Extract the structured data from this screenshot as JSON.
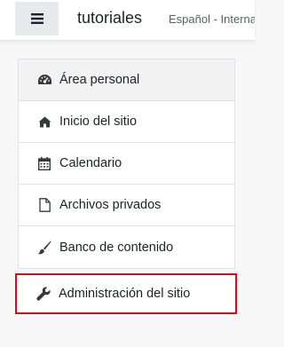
{
  "navbar": {
    "site_name": "tutoriales",
    "language": "Español - Internacional",
    "menu_icon": "hamburger-icon"
  },
  "drawer": {
    "items": [
      {
        "label": "Área personal",
        "icon": "dashboard-icon",
        "active": true
      },
      {
        "label": "Inicio del sitio",
        "icon": "home-icon"
      },
      {
        "label": "Calendario",
        "icon": "calendar-icon"
      },
      {
        "label": "Archivos privados",
        "icon": "file-icon"
      },
      {
        "label": "Banco de contenido",
        "icon": "paint-brush-icon"
      }
    ],
    "admin": {
      "label": "Administración del sitio",
      "icon": "wrench-icon"
    }
  },
  "colors": {
    "highlight_border": "#d40e1b",
    "menu_button_bg": "#e7e9ec",
    "active_item_bg": "#f2f2f2"
  }
}
